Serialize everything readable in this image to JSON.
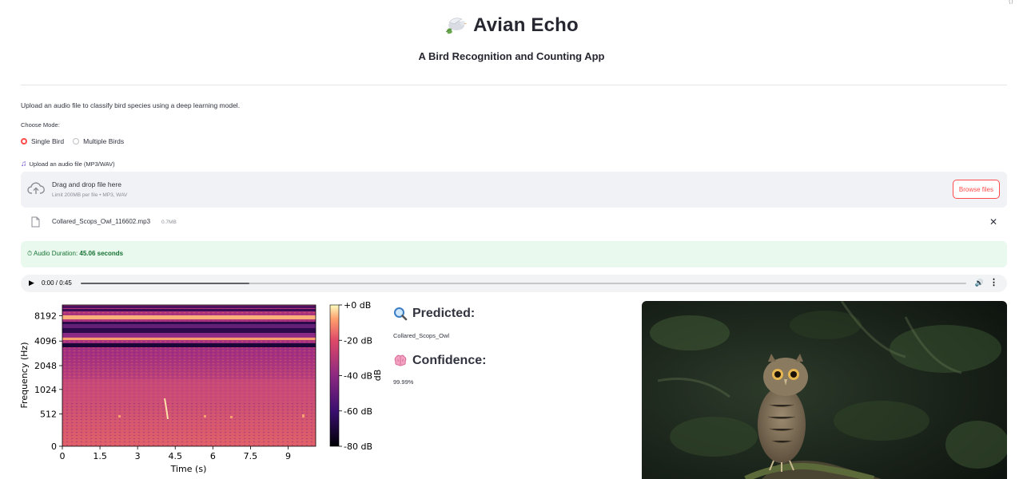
{
  "app": {
    "title": "Avian Echo",
    "subtitle": "A Bird Recognition and Counting App",
    "description": "Upload an audio file to classify bird species using a deep learning model."
  },
  "mode": {
    "label": "Choose Mode:",
    "options": [
      "Single Bird",
      "Multiple Birds"
    ],
    "selected": "Single Bird"
  },
  "uploader": {
    "label": "Upload an audio file (MP3/WAV)",
    "dropzone_text": "Drag and drop file here",
    "limit_text": "Limit 200MB per file • MP3, WAV",
    "browse_label": "Browse files",
    "file_name": "Collared_Scops_Owl_116602.mp3",
    "file_size": "0.7MB"
  },
  "status": {
    "prefix": "⏱ Audio Duration: ",
    "value": "45.06 seconds"
  },
  "player": {
    "time": "0:00 / 0:45",
    "progress": 0.19
  },
  "spectrogram": {
    "ylabel": "Frequency (Hz)",
    "xlabel": "Time (s)",
    "yticks": [
      "8192",
      "4096",
      "2048",
      "1024",
      "512",
      "0"
    ],
    "xticks": [
      "0",
      "1.5",
      "3",
      "4.5",
      "6",
      "7.5",
      "9"
    ],
    "colorbar_ticks": [
      "+0 dB",
      "-20 dB",
      "-40 dB",
      "-60 dB",
      "-80 dB"
    ],
    "colorbar_label": "dB"
  },
  "result": {
    "predicted_title": "Predicted:",
    "predicted_value": "Collared_Scops_Owl",
    "confidence_title": "Confidence:",
    "confidence_value": "99.99%"
  },
  "colors": {
    "accent": "#ff4b4b",
    "success_bg": "#e9f9ee",
    "success_text": "#177233",
    "dropzone_bg": "#f0f2f6"
  }
}
